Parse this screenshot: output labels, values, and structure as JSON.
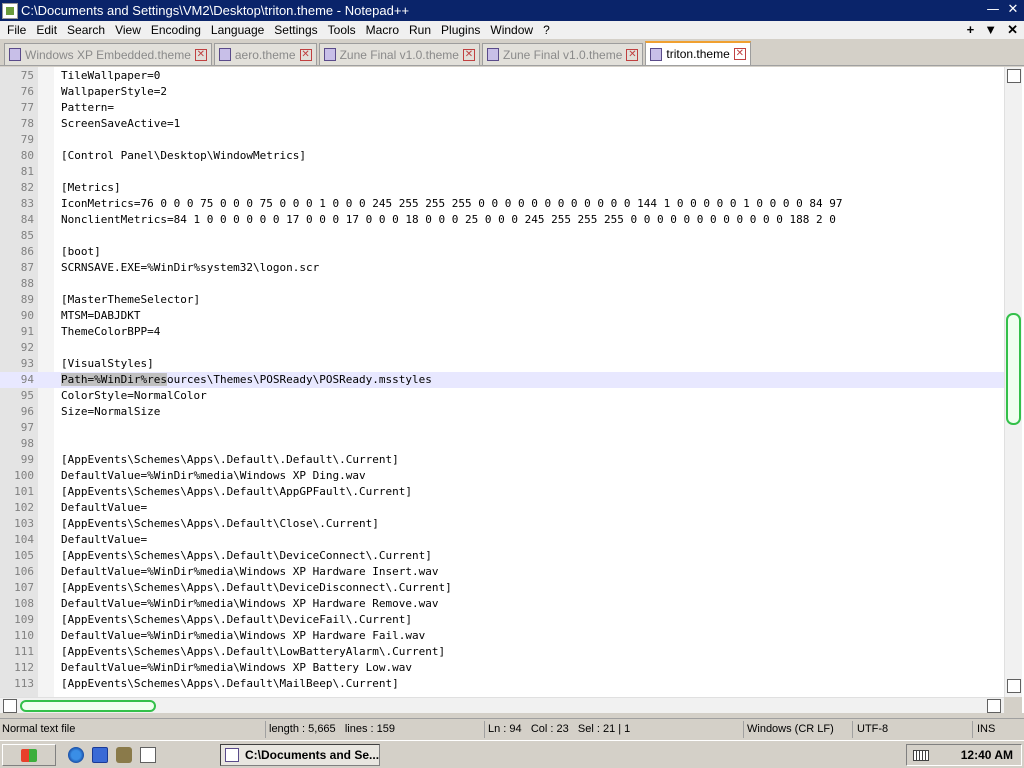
{
  "window": {
    "title": "C:\\Documents and Settings\\VM2\\Desktop\\triton.theme - Notepad++",
    "minimize_glyph": "—",
    "close_glyph": "✕"
  },
  "menubar": {
    "items": [
      "File",
      "Edit",
      "Search",
      "View",
      "Encoding",
      "Language",
      "Settings",
      "Tools",
      "Macro",
      "Run",
      "Plugins",
      "Window",
      "?"
    ],
    "right": [
      "+",
      "▼",
      "✕"
    ]
  },
  "tabs": [
    {
      "label": "Windows XP Embedded.theme",
      "active": false
    },
    {
      "label": "aero.theme",
      "active": false
    },
    {
      "label": "Zune Final v1.0.theme",
      "active": false
    },
    {
      "label": "Zune Final v1.0.theme",
      "active": false
    },
    {
      "label": "triton.theme",
      "active": true
    }
  ],
  "editor": {
    "current_line": 94,
    "lines": [
      {
        "n": "75",
        "t": "TileWallpaper=0"
      },
      {
        "n": "76",
        "t": "WallpaperStyle=2"
      },
      {
        "n": "77",
        "t": "Pattern="
      },
      {
        "n": "78",
        "t": "ScreenSaveActive=1"
      },
      {
        "n": "79",
        "t": ""
      },
      {
        "n": "80",
        "t": "[Control Panel\\Desktop\\WindowMetrics]"
      },
      {
        "n": "81",
        "t": ""
      },
      {
        "n": "82",
        "t": "[Metrics]"
      },
      {
        "n": "83",
        "t": "IconMetrics=76 0 0 0 75 0 0 0 75 0 0 0 1 0 0 0 245 255 255 255 0 0 0 0 0 0 0 0 0 0 0 0 144 1 0 0 0 0 0 1 0 0 0 0 84 97"
      },
      {
        "n": "84",
        "t": "NonclientMetrics=84 1 0 0 0 0 0 0 17 0 0 0 17 0 0 0 18 0 0 0 25 0 0 0 245 255 255 255 0 0 0 0 0 0 0 0 0 0 0 0 188 2 0"
      },
      {
        "n": "85",
        "t": ""
      },
      {
        "n": "86",
        "t": "[boot]"
      },
      {
        "n": "87",
        "t": "SCRNSAVE.EXE=%WinDir%system32\\logon.scr"
      },
      {
        "n": "88",
        "t": ""
      },
      {
        "n": "89",
        "t": "[MasterThemeSelector]"
      },
      {
        "n": "90",
        "t": "MTSM=DABJDKT"
      },
      {
        "n": "91",
        "t": "ThemeColorBPP=4"
      },
      {
        "n": "92",
        "t": ""
      },
      {
        "n": "93",
        "t": "[VisualStyles]"
      },
      {
        "n": "94",
        "t": "Path=%WinDir%resources\\Themes\\POSReady\\POSReady.msstyles",
        "sel_prefix": "Path=%WinDir%res",
        "sel_rest": "ources\\Themes\\POSReady\\POSReady.msstyles"
      },
      {
        "n": "95",
        "t": "ColorStyle=NormalColor"
      },
      {
        "n": "96",
        "t": "Size=NormalSize"
      },
      {
        "n": "97",
        "t": ""
      },
      {
        "n": "98",
        "t": ""
      },
      {
        "n": "99",
        "t": "[AppEvents\\Schemes\\Apps\\.Default\\.Default\\.Current]"
      },
      {
        "n": "100",
        "t": "DefaultValue=%WinDir%media\\Windows XP Ding.wav"
      },
      {
        "n": "101",
        "t": "[AppEvents\\Schemes\\Apps\\.Default\\AppGPFault\\.Current]"
      },
      {
        "n": "102",
        "t": "DefaultValue="
      },
      {
        "n": "103",
        "t": "[AppEvents\\Schemes\\Apps\\.Default\\Close\\.Current]"
      },
      {
        "n": "104",
        "t": "DefaultValue="
      },
      {
        "n": "105",
        "t": "[AppEvents\\Schemes\\Apps\\.Default\\DeviceConnect\\.Current]"
      },
      {
        "n": "106",
        "t": "DefaultValue=%WinDir%media\\Windows XP Hardware Insert.wav"
      },
      {
        "n": "107",
        "t": "[AppEvents\\Schemes\\Apps\\.Default\\DeviceDisconnect\\.Current]"
      },
      {
        "n": "108",
        "t": "DefaultValue=%WinDir%media\\Windows XP Hardware Remove.wav"
      },
      {
        "n": "109",
        "t": "[AppEvents\\Schemes\\Apps\\.Default\\DeviceFail\\.Current]"
      },
      {
        "n": "110",
        "t": "DefaultValue=%WinDir%media\\Windows XP Hardware Fail.wav"
      },
      {
        "n": "111",
        "t": "[AppEvents\\Schemes\\Apps\\.Default\\LowBatteryAlarm\\.Current]"
      },
      {
        "n": "112",
        "t": "DefaultValue=%WinDir%media\\Windows XP Battery Low.wav"
      },
      {
        "n": "113",
        "t": "[AppEvents\\Schemes\\Apps\\.Default\\MailBeep\\.Current]"
      }
    ]
  },
  "status": {
    "file_type": "Normal text file",
    "length": "length : 5,665",
    "lines": "lines : 159",
    "ln": "Ln : 94",
    "col": "Col : 23",
    "sel": "Sel : 21 | 1",
    "eol": "Windows (CR LF)",
    "encoding": "UTF-8",
    "mode": "INS"
  },
  "taskbar": {
    "task_label": "C:\\Documents and Se...",
    "clock": "12:40 AM"
  },
  "colors": {
    "titlebar": "#0a246a",
    "scroll_thumb": "#33c04a",
    "current_line": "#e8e8ff"
  }
}
